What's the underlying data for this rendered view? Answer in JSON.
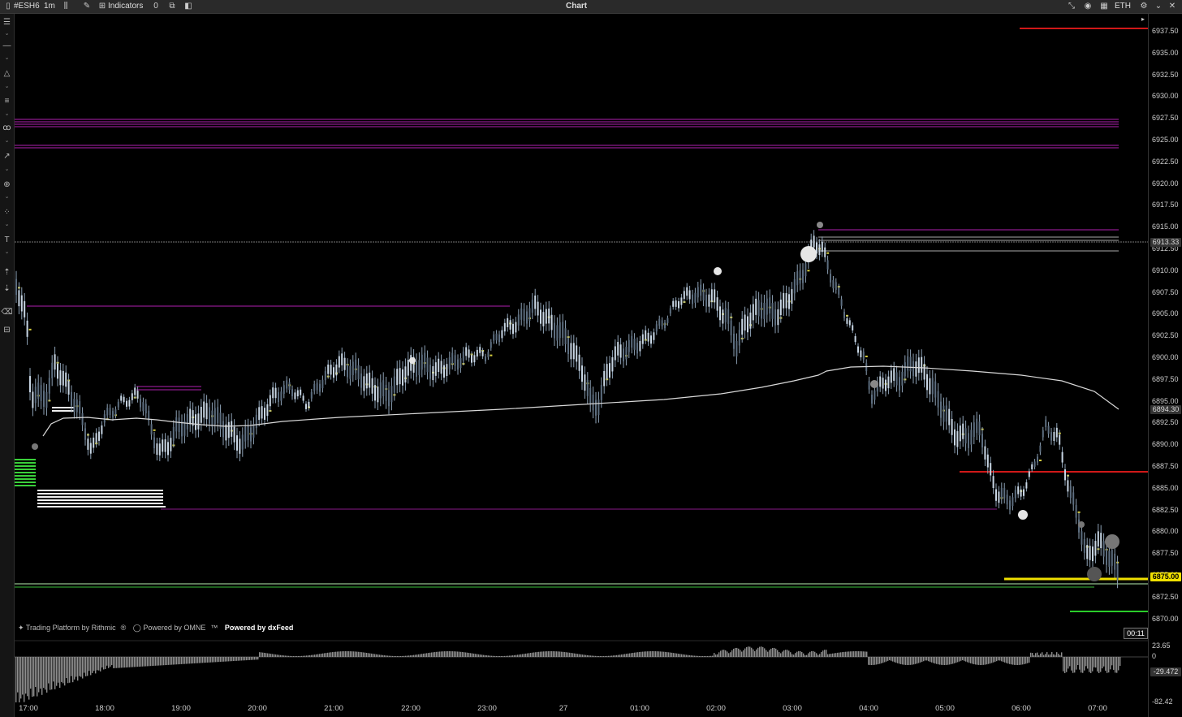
{
  "titlebar": {
    "symbol": "#ESH6",
    "interval": "1m",
    "indicators_label": "Indicators",
    "window_title": "Chart",
    "session": "ETH"
  },
  "price_axis": {
    "ticks": [
      "6937.50",
      "6935.00",
      "6932.50",
      "6930.00",
      "6927.50",
      "6925.00",
      "6922.50",
      "6920.00",
      "6917.50",
      "6915.00",
      "6912.50",
      "6910.00",
      "6907.50",
      "6905.00",
      "6902.50",
      "6900.00",
      "6897.50",
      "6895.00",
      "6892.50",
      "6890.00",
      "6887.50",
      "6885.00",
      "6882.50",
      "6880.00",
      "6877.50",
      "6875.00",
      "6872.50",
      "6870.00"
    ],
    "labels": {
      "hline_price": "6913.33",
      "vwap_price": "6894.30",
      "last_price": "6875.00"
    }
  },
  "indicator_axis": {
    "top": "23.65",
    "zero": "0",
    "current": "-29.472",
    "bottom": "-82.42"
  },
  "time_axis": [
    "17:00",
    "18:00",
    "19:00",
    "20:00",
    "21:00",
    "22:00",
    "23:00",
    "27",
    "01:00",
    "02:00",
    "03:00",
    "04:00",
    "05:00",
    "06:00",
    "07:00"
  ],
  "credits": {
    "rithmic": "Trading Platform by Rithmic",
    "omne": "Powered by OMNE",
    "dxfeed": "Powered by dxFeed"
  },
  "bar_timer": "00:11",
  "colors": {
    "background": "#000000",
    "candle": "#a9bcd0",
    "vwap": "#d9d9d9",
    "magenta_level": "#b020b0",
    "red_level": "#d01818",
    "yellow_level": "#f0e000",
    "green_level": "#4ad04a",
    "last_price_label": "#f0e000"
  }
}
